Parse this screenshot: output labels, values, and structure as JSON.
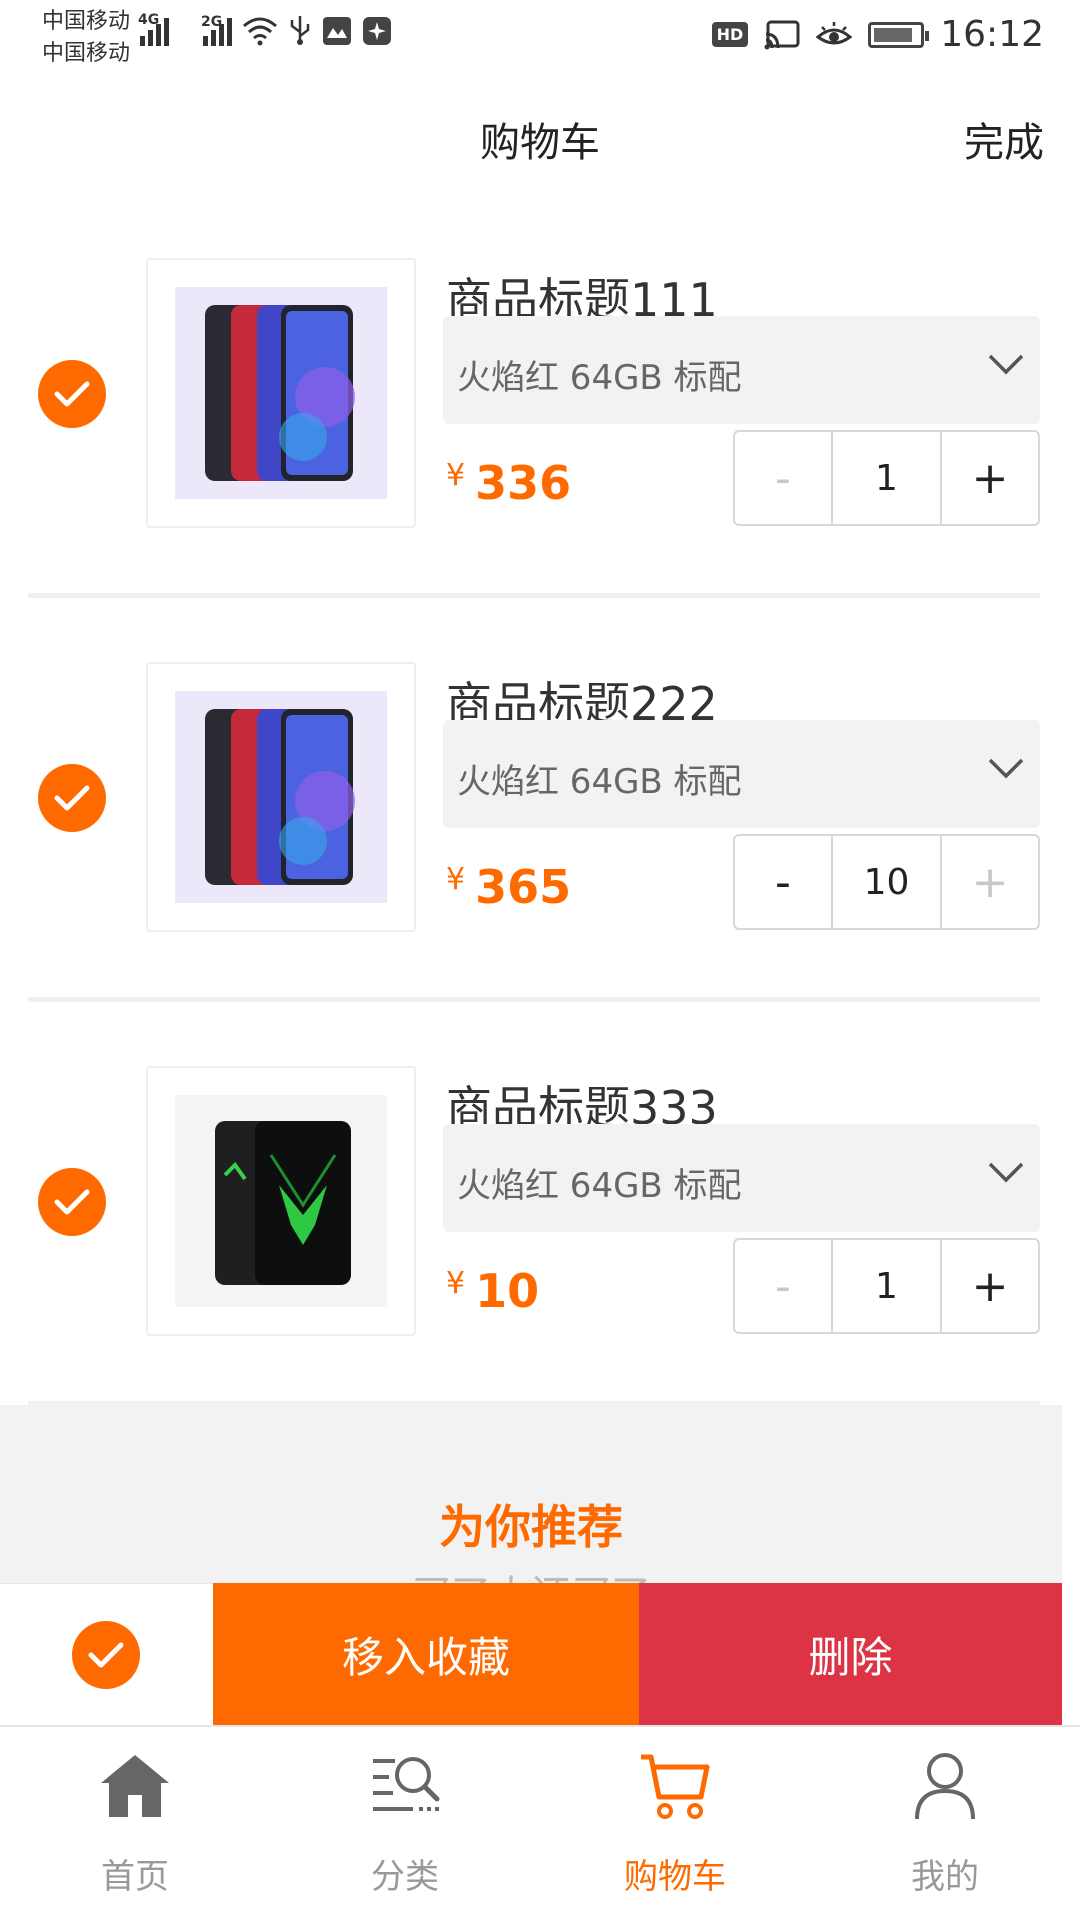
{
  "status_bar": {
    "carrier_1": "中国移动",
    "carrier_2": "中国移动",
    "net_1": "4G",
    "net_2": "2G",
    "hd_badge": "HD",
    "time": "16:12"
  },
  "header": {
    "title": "购物车",
    "done_label": "完成"
  },
  "cart_items": [
    {
      "title": "商品标题111",
      "spec": "火焰红 64GB 标配",
      "currency": "¥",
      "price": "336",
      "quantity": "1",
      "minus": "-",
      "plus": "+",
      "checked": true,
      "image": "phone-trio-blue-red-black"
    },
    {
      "title": "商品标题222",
      "spec": "火焰红 64GB 标配",
      "currency": "¥",
      "price": "365",
      "quantity": "10",
      "minus": "-",
      "plus": "+",
      "checked": true,
      "image": "phone-trio-blue-red-black"
    },
    {
      "title": "商品标题333",
      "spec": "火焰红 64GB 标配",
      "currency": "¥",
      "price": "10",
      "quantity": "1",
      "minus": "-",
      "plus": "+",
      "checked": true,
      "image": "gaming-phone-black-green"
    }
  ],
  "recommend": {
    "title": "为你推荐",
    "subtitle_partial": "买了大还买了"
  },
  "action_bar": {
    "select_all_checked": true,
    "favorite_label": "移入收藏",
    "delete_label": "删除"
  },
  "tabs": [
    {
      "label": "首页",
      "icon": "home-icon",
      "active": false
    },
    {
      "label": "分类",
      "icon": "category-search-icon",
      "active": false
    },
    {
      "label": "购物车",
      "icon": "cart-icon",
      "active": true
    },
    {
      "label": "我的",
      "icon": "user-icon",
      "active": false
    }
  ],
  "colors": {
    "accent": "#ff6a00",
    "danger": "#dd3445",
    "spec_bg": "#f2f2f2"
  }
}
